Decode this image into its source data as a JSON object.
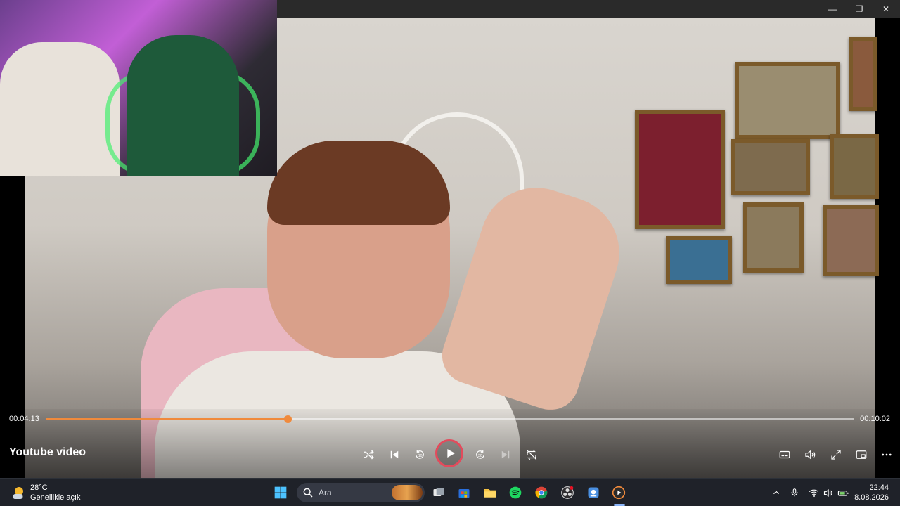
{
  "window": {
    "minimize_glyph": "—",
    "maximize_glyph": "❐",
    "close_glyph": "✕"
  },
  "player": {
    "title": "Youtube video",
    "current_time": "00:04:13",
    "total_time": "00:10:02",
    "progress_fraction": 0.2989,
    "accent_color": "#f08a3c",
    "play_ring_color": "#e34b5c",
    "controls": [
      "shuffle-icon",
      "previous-icon",
      "rewind-10-icon",
      "play-icon",
      "forward-30-icon",
      "next-icon",
      "repeat-off-icon"
    ],
    "right_controls": [
      "subtitles-icon",
      "volume-icon",
      "fullscreen-icon",
      "mini-player-icon",
      "more-icon"
    ]
  },
  "taskbar": {
    "weather": {
      "temp": "28°C",
      "desc": "Genellikle açık",
      "icon": "partly-sunny-icon"
    },
    "search_placeholder": "Ara",
    "apps": [
      "windows-start-icon",
      "search-icon",
      "task-view-icon",
      "microsoft-store-icon",
      "file-explorer-icon",
      "spotify-icon",
      "chrome-icon",
      "obs-icon",
      "app-icon",
      "media-player-icon"
    ],
    "clock": {
      "time": "22:44",
      "date": "8.08.2026"
    },
    "tray": [
      "chevron-up-icon",
      "microphone-icon",
      "wifi-icon",
      "speaker-icon",
      "battery-icon"
    ]
  }
}
